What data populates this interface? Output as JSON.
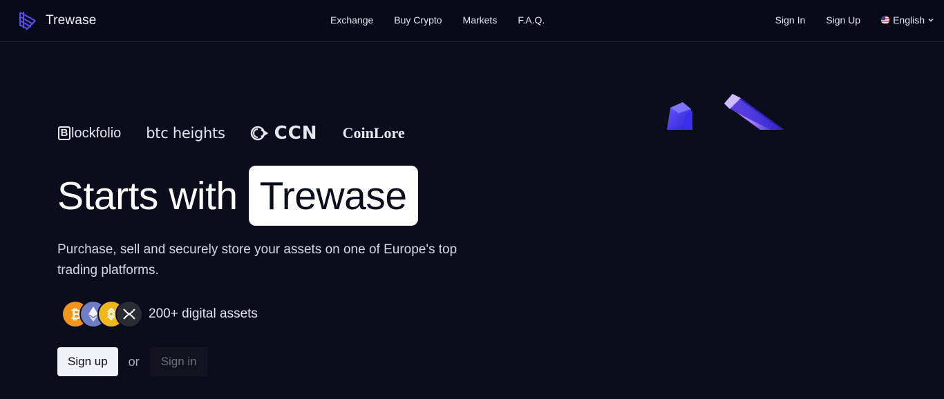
{
  "header": {
    "brand": "Trewase",
    "nav": [
      "Exchange",
      "Buy Crypto",
      "Markets",
      "F.A.Q."
    ],
    "sign_in": "Sign In",
    "sign_up": "Sign Up",
    "language": "English"
  },
  "press": {
    "blockfolio": "lockfolio",
    "btc_heights": "btc heights",
    "ccn": "CCN",
    "coinlore": "CoinLore"
  },
  "hero": {
    "title_lead": "Starts with",
    "title_highlight": "Trewase",
    "subtitle": "Purchase, sell and securely store your assets on one of Europe's top trading platforms.",
    "assets_label": "200+ digital assets",
    "coins": [
      "bitcoin",
      "ethereum",
      "bnb",
      "xrp"
    ]
  },
  "cta": {
    "primary": "Sign up",
    "or": "or",
    "secondary": "Sign in"
  },
  "colors": {
    "background": "#0b0c1c",
    "header_bg": "#070919",
    "accent": "#4a3cff"
  }
}
